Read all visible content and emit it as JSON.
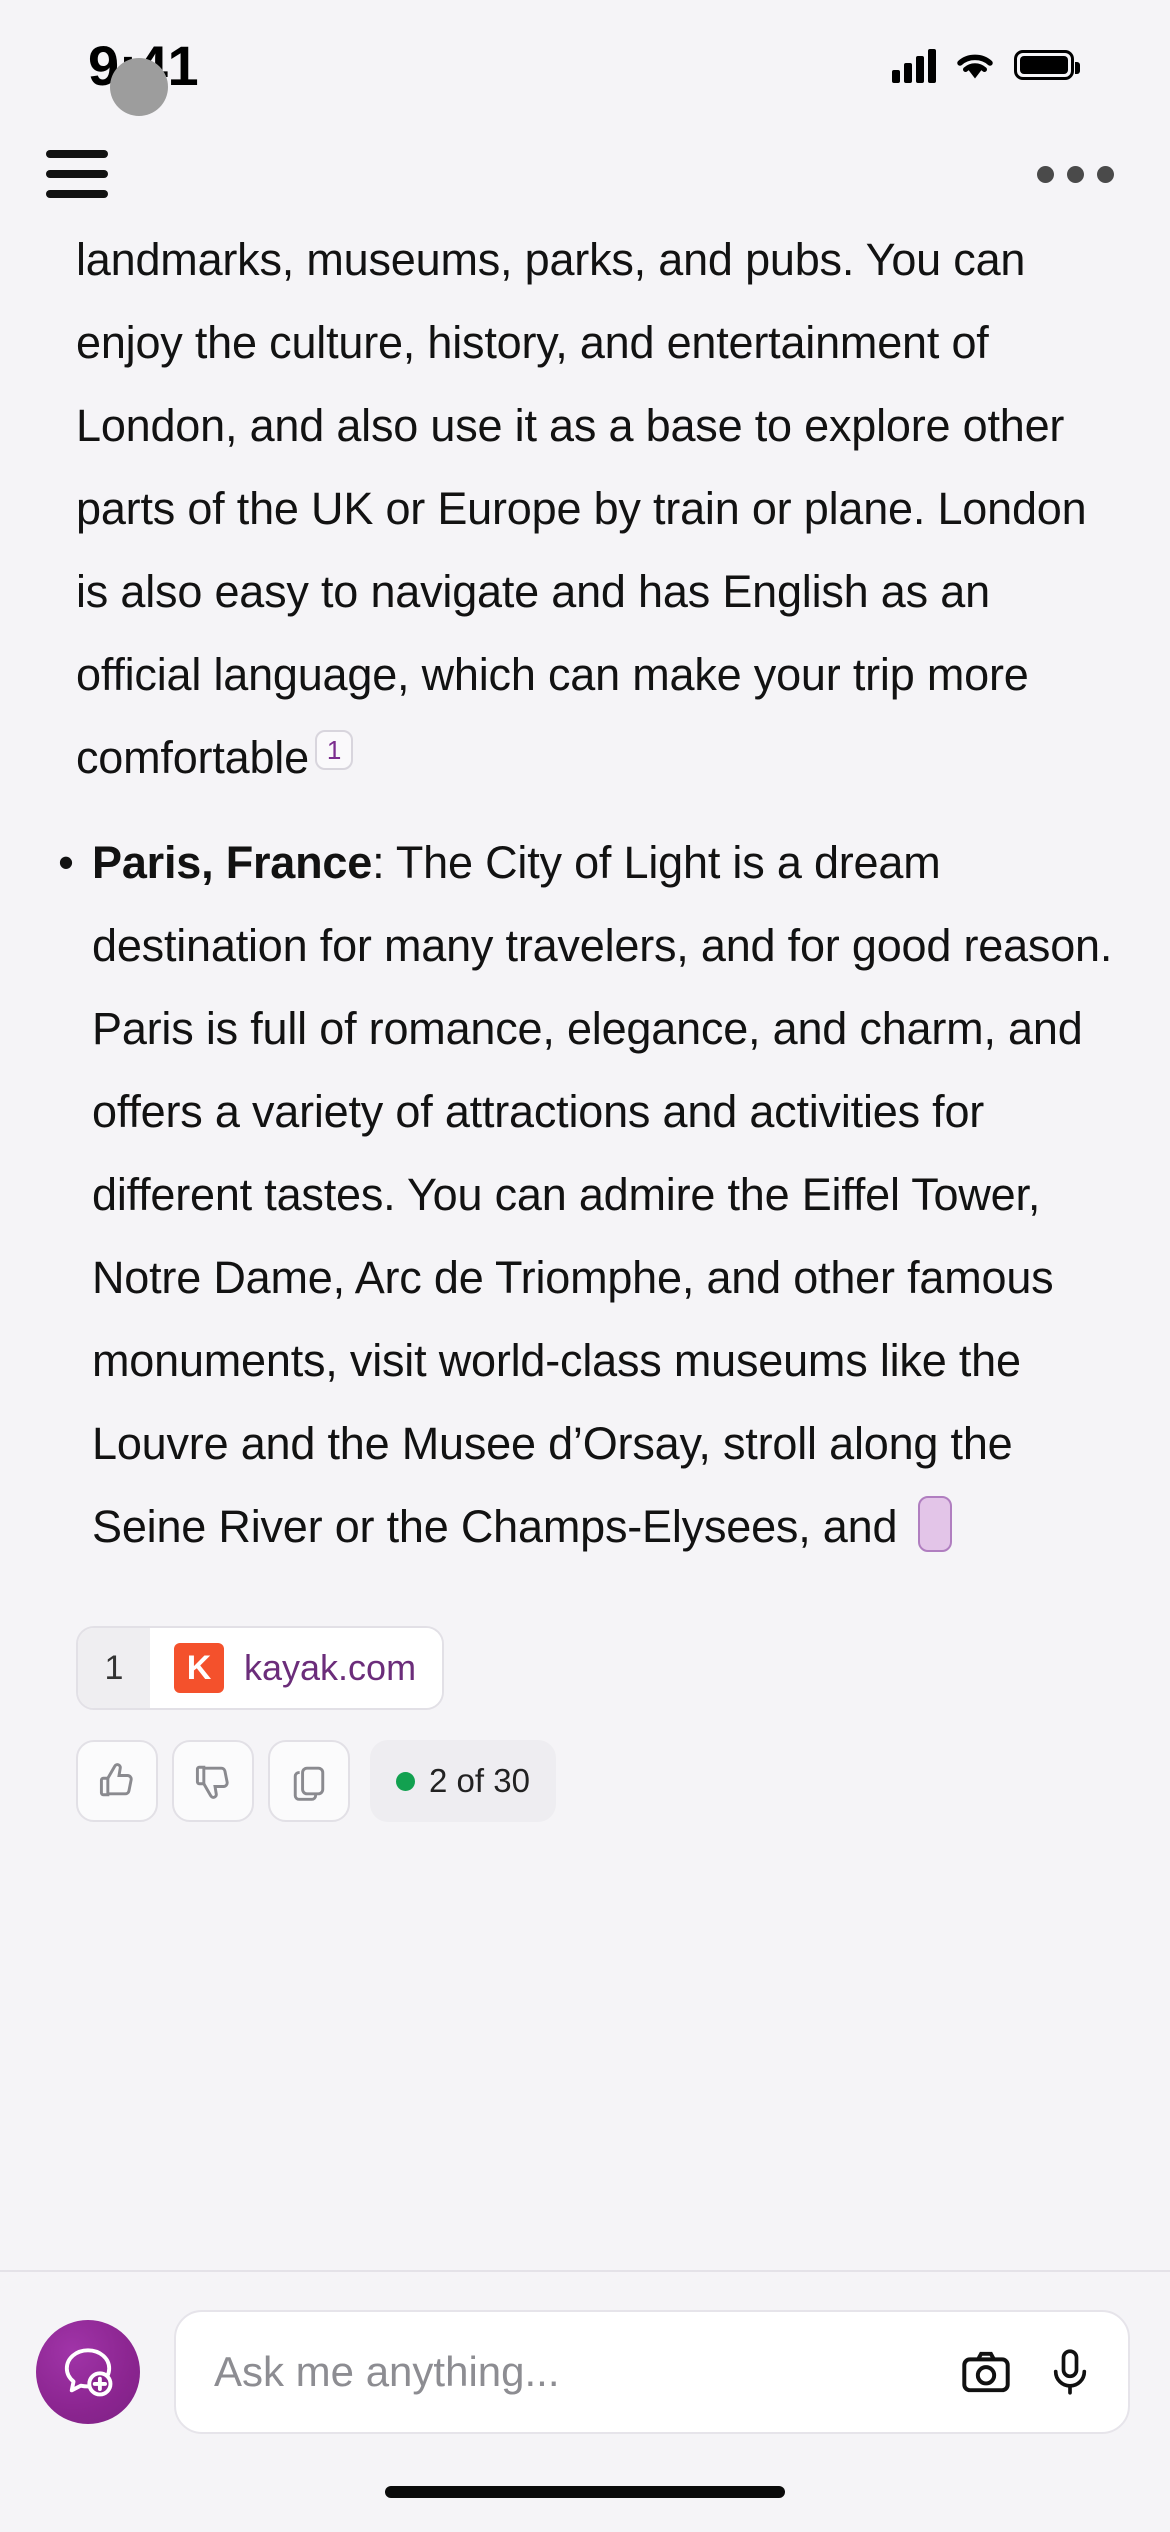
{
  "status_bar": {
    "time": "9:41",
    "signal_icon": "cellular-signal-icon",
    "wifi_icon": "wifi-icon",
    "battery_icon": "battery-full-icon"
  },
  "top_nav": {
    "menu_icon": "hamburger-menu-icon",
    "avatar": "user-avatar",
    "overflow_icon": "more-options-icon"
  },
  "message": {
    "paragraph_continuation": "landmarks, museums, parks, and pubs. You can enjoy the culture, history, and entertainment of London, and also use it as a base to explore other parts of the UK or Europe by train or plane. London is also easy to navigate and has English as an official language, which can make your trip more comfortable",
    "citation_marker": "1",
    "bullet": {
      "marker": "•",
      "title": "Paris, France",
      "title_suffix": ": ",
      "body": "The City of Light is a dream destination for many travelers, and for good reason. Paris is full of romance, elegance, and charm, and offers a variety of attractions and activities for different tastes. You can admire the Eiffel Tower, Notre Dame, Arc de Triomphe, and other famous monuments, visit world-class museums like the Louvre and the Musee d’Orsay, stroll along the Seine River or the Champs-Elysees, and "
    }
  },
  "sources": [
    {
      "number": "1",
      "logo_letter": "K",
      "logo_color": "#f4512c",
      "name": "kayak.com",
      "name_color": "#6b2d7a"
    }
  ],
  "actions": {
    "thumbs_up_icon": "thumbs-up-icon",
    "thumbs_down_icon": "thumbs-down-icon",
    "copy_icon": "copy-icon",
    "counter_text": "2 of 30",
    "counter_dot_color": "#12a150"
  },
  "composer": {
    "assistant_icon": "new-chat-bubble-icon",
    "assistant_color": "#8b2590",
    "placeholder": "Ask me anything...",
    "camera_icon": "camera-icon",
    "microphone_icon": "microphone-icon"
  }
}
